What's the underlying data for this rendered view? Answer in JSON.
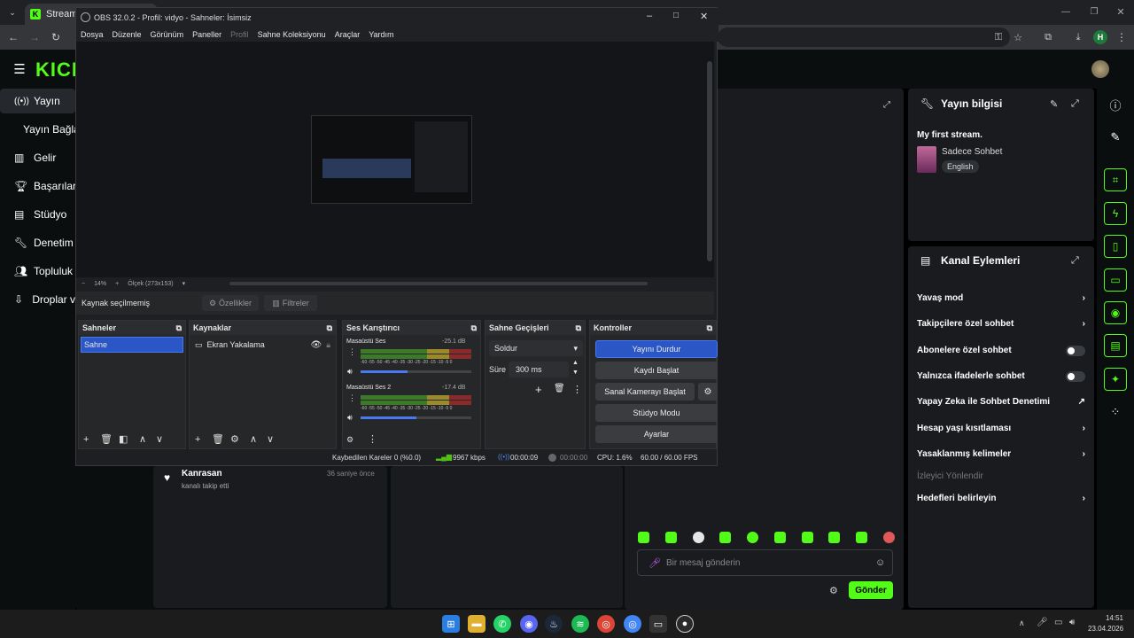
{
  "browser": {
    "tab_title": "Stream - K",
    "url_placeholder": "",
    "profile_initial": "H"
  },
  "kick": {
    "logo": "KICK",
    "sidebar": [
      {
        "label": "Yayın",
        "icon": "broadcast-icon"
      },
      {
        "label": "Yayın Bağla",
        "icon": ""
      },
      {
        "label": "Gelir",
        "icon": "chart-icon"
      },
      {
        "label": "Başarılar",
        "icon": "trophy-icon"
      },
      {
        "label": "Stüdyo",
        "icon": "studio-icon"
      },
      {
        "label": "Denetim",
        "icon": "wrench-icon"
      },
      {
        "label": "Topluluk",
        "icon": "people-icon"
      },
      {
        "label": "Droplar v",
        "icon": "drop-icon"
      }
    ],
    "activity": {
      "name": "Kanrasan",
      "time": "36 saniye önce",
      "text": "kanalı takip etti"
    },
    "info": {
      "title": "Yayın bilgisi",
      "stream_title": "My first stream.",
      "category": "Sadece Sohbet",
      "language": "English"
    },
    "actions": {
      "title": "Kanal Eylemleri",
      "items": [
        {
          "label": "Yavaş mod",
          "control": "chevron"
        },
        {
          "label": "Takipçilere özel sohbet",
          "control": "chevron"
        },
        {
          "label": "Abonelere özel sohbet",
          "control": "toggle"
        },
        {
          "label": "Yalnızca ifadelerle sohbet",
          "control": "toggle"
        },
        {
          "label": "Yapay Zeka ile Sohbet Denetimi",
          "control": "external"
        },
        {
          "label": "Hesap yaşı kısıtlaması",
          "control": "chevron"
        },
        {
          "label": "Yasaklanmış kelimeler",
          "control": "chevron"
        },
        {
          "label": "İzleyici Yönlendir",
          "control": "none"
        },
        {
          "label": "Hedefleri belirleyin",
          "control": "chevron"
        }
      ]
    },
    "chat": {
      "placeholder": "Bir mesaj gönderin",
      "send": "Gönder"
    },
    "accent": "#53fc18"
  },
  "obs": {
    "title": "OBS 32.0.2 - Profil: vidyo - Sahneler: İsimsiz",
    "menu": [
      "Dosya",
      "Düzenle",
      "Görünüm",
      "Paneller",
      "Profil",
      "Sahne Koleksiyonu",
      "Araçlar",
      "Yardım"
    ],
    "zoom": "14%",
    "scale": "Ölçek (273x153)",
    "no_source": "Kaynak seçilmemiş",
    "properties": "Özellikler",
    "filters": "Filtreler",
    "scenes": {
      "title": "Sahneler",
      "items": [
        "Sahne"
      ]
    },
    "sources": {
      "title": "Kaynaklar",
      "items": [
        "Ekran Yakalama"
      ]
    },
    "mixer": {
      "title": "Ses Karıştırıcı",
      "channels": [
        {
          "name": "Masaüstü Ses",
          "db": "-25.1 dB",
          "level": 0.42
        },
        {
          "name": "Masaüstü Ses 2",
          "db": "-17.4 dB",
          "level": 0.5
        }
      ],
      "scale": "-60 -55 -50 -45 -40 -35 -30 -25 -20 -15 -10 -5 0"
    },
    "transitions": {
      "title": "Sahne Geçişleri",
      "type": "Soldur",
      "duration_label": "Süre",
      "duration": "300 ms"
    },
    "controls": {
      "title": "Kontroller",
      "buttons": [
        "Yayını Durdur",
        "Kaydı Başlat",
        "Sanal Kamerayı Başlat",
        "Stüdyo Modu",
        "Ayarlar"
      ]
    },
    "status": {
      "dropped": "Kaybedilen Kareler 0 (%0.0)",
      "bitrate": "9967 kbps",
      "stream_time": "00:00:09",
      "rec_time": "00:00:00",
      "cpu": "CPU: 1.6%",
      "fps": "60.00 / 60.00 FPS"
    }
  },
  "taskbar": {
    "time": "14:51",
    "date": "23.04.2026"
  }
}
